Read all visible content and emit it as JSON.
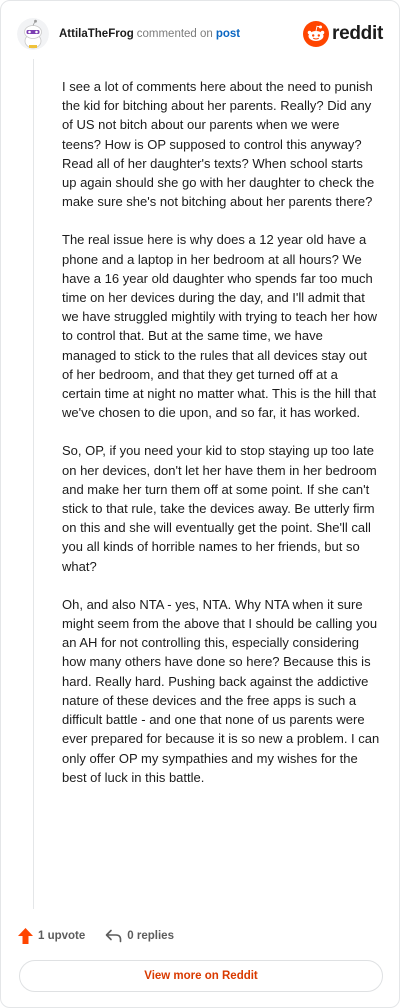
{
  "header": {
    "username": "AttilaTheFrog",
    "action_text": "commented on",
    "post_link": "post",
    "brand": "reddit"
  },
  "comment": {
    "paragraphs": [
      "I see a lot of comments here about the need to punish the kid for bitching about her parents. Really? Did any of US not bitch about our parents when we were teens? How is OP supposed to control this anyway? Read all of her daughter's texts? When school starts up again should she go with her daughter to check the make sure she's not bitching about her parents there?",
      "The real issue here is why does a 12 year old have a phone and a laptop in her bedroom at all hours? We have a 16 year old daughter who spends far too much time on her devices during the day, and I'll admit that we have struggled mightily with trying to teach her how to control that. But at the same time, we have managed to stick to the rules that all devices stay out of her bedroom, and that they get turned off at a certain time at night no matter what. This is the hill that we've chosen to die upon, and so far, it has worked.",
      "So, OP, if you need your kid to stop staying up too late on her devices, don't let her have them in her bedroom and make her turn them off at some point. If she can't stick to that rule, take the devices away. Be utterly firm on this and she will eventually get the point. She'll call you all kinds of horrible names to her friends, but so what?",
      "Oh, and also NTA - yes, NTA. Why NTA when it sure might seem from the above that I should be calling you an AH for not controlling this, especially considering how many others have done so here? Because this is hard. Really hard. Pushing back against the addictive nature of these devices and the free apps is such a difficult battle - and one that none of us parents were ever prepared for because it is so new a problem. I can only offer OP my sympathies and my wishes for the best of luck in this battle."
    ]
  },
  "actions": {
    "upvotes": "1 upvote",
    "replies": "0 replies"
  },
  "footer": {
    "view_more": "View more on Reddit"
  },
  "colors": {
    "brand_orange": "#ff4500",
    "upvote_color": "#ff4500",
    "link_blue": "#0a66c2",
    "view_more_text": "#d93a00"
  },
  "icons": {
    "avatar": "snoo-avatar-icon",
    "logo": "reddit-snoo-icon",
    "upvote": "upvote-arrow-icon",
    "reply": "reply-arrow-icon"
  }
}
